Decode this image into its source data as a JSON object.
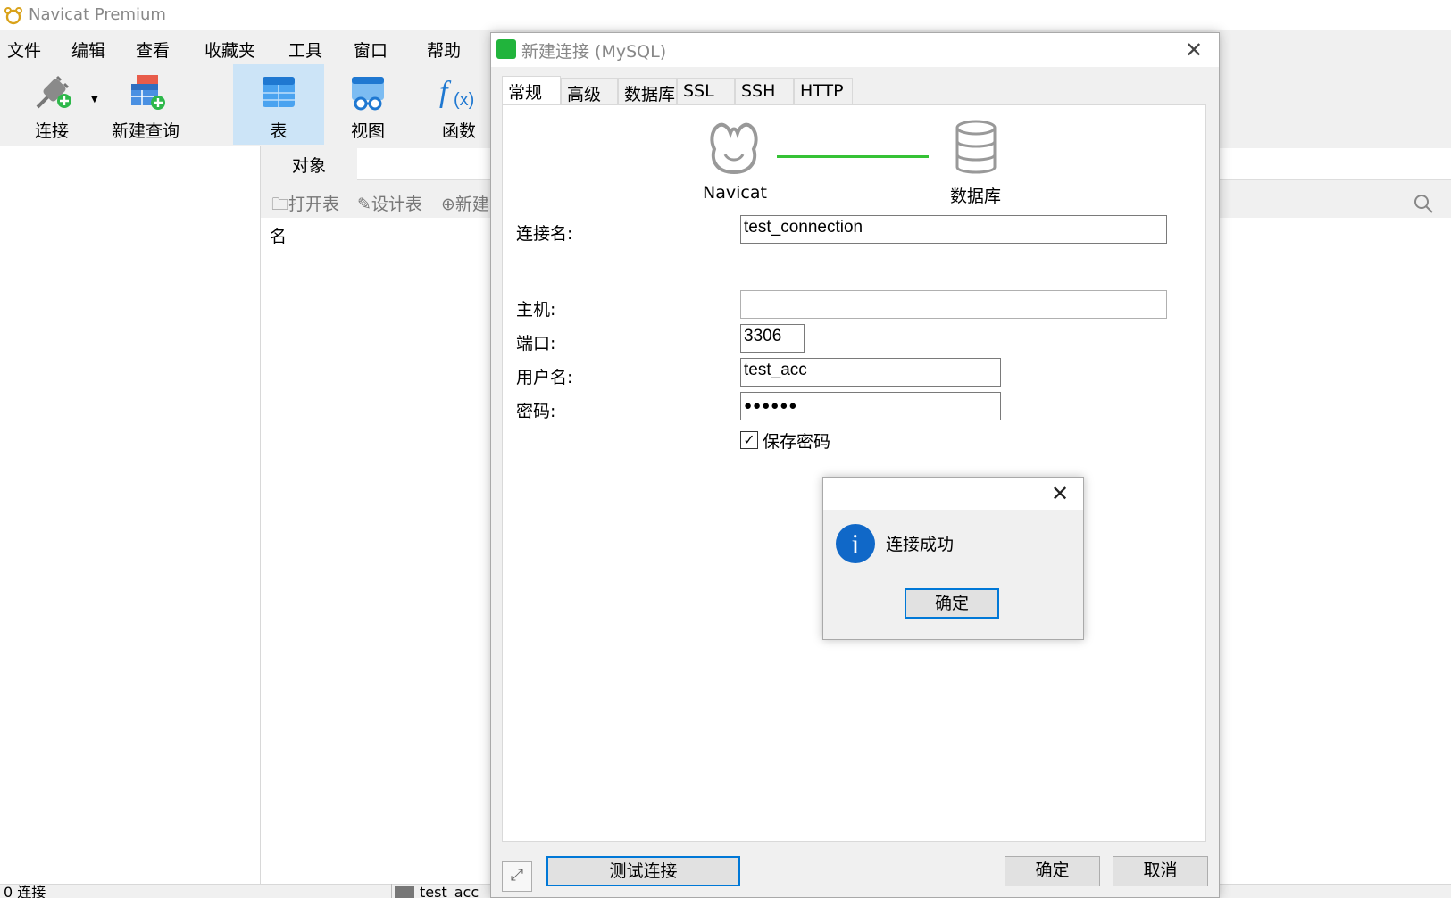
{
  "app": {
    "title": "Navicat Premium"
  },
  "menu": [
    "文件",
    "编辑",
    "查看",
    "收藏夹",
    "工具",
    "窗口",
    "帮助"
  ],
  "toolbar": {
    "connect": "连接",
    "new_query": "新建查询",
    "table": "表",
    "view": "视图",
    "function": "函数"
  },
  "objects": {
    "tab_label": "对象",
    "open_table": "打开表",
    "design_table": "设计表",
    "new_table": "新建",
    "column_name": "名"
  },
  "status": {
    "left": "0 连接",
    "connection": "test_acc"
  },
  "connection_dialog": {
    "title": "新建连接 (MySQL)",
    "tabs": [
      "常规",
      "高级",
      "数据库",
      "SSL",
      "SSH",
      "HTTP"
    ],
    "active_tab": "常规",
    "navicat_label": "Navicat",
    "db_label": "数据库",
    "fields": {
      "conn_name_label": "连接名:",
      "conn_name_value": "test_connection",
      "host_label": "主机:",
      "host_value": "",
      "port_label": "端口:",
      "port_value": "3306",
      "user_label": "用户名:",
      "user_value": "test_acc",
      "password_label": "密码:",
      "password_value": "●●●●●●"
    },
    "save_password_label": "保存密码",
    "save_password_checked": true,
    "test_button": "测试连接",
    "ok_button": "确定",
    "cancel_button": "取消"
  },
  "message_box": {
    "text": "连接成功",
    "ok_button": "确定"
  },
  "colors": {
    "accent": "#0078d7",
    "selected_tool": "#cce4f7",
    "info": "#1068c8",
    "link_line": "#35c235"
  }
}
